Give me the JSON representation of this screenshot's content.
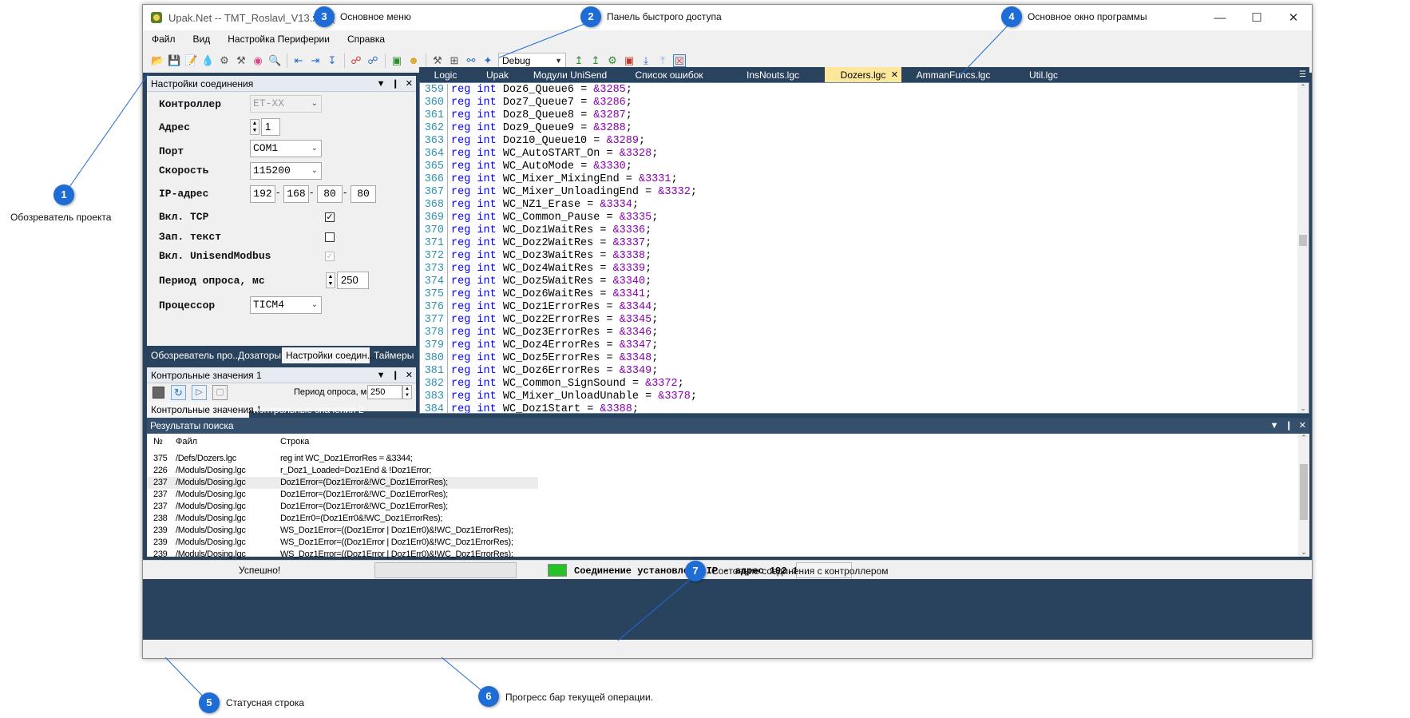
{
  "window": {
    "title": "Upak.Net -- TMT_Roslavl_V13.xml ("
  },
  "menu": [
    "Файл",
    "Вид",
    "Настройка Периферии",
    "Справка"
  ],
  "toolbar": {
    "config": "Debug",
    "icons": [
      "open-icon",
      "save-icon",
      "save-as-icon",
      "fire-icon",
      "settings-icon",
      "tools-icon",
      "color-wheel-icon",
      "search-icon",
      "align-left-icon",
      "align-right-icon",
      "download-icon",
      "link-icon",
      "unlink-icon",
      "chip-icon",
      "smile-icon",
      "hammer-icon",
      "grid-icon",
      "glasses-icon",
      "broom-icon",
      "upload-green-icon",
      "upload-green2-icon",
      "gear-green-icon",
      "stop-icon",
      "download-blue-icon",
      "upload-blue-icon",
      "disconnect-icon"
    ]
  },
  "conn_panel": {
    "title": "Настройки соединения",
    "labels": {
      "controller": "Контроллер",
      "address": "Адрес",
      "port": "Порт",
      "speed": "Скорость",
      "ip": "IP-адрес",
      "tcp": "Вкл. TCP",
      "write_text": "Зап. текст",
      "unisend": "Вкл. UnisendModbus",
      "period": "Период опроса, мс",
      "processor": "Процессор"
    },
    "values": {
      "controller": "ET-XX",
      "address": "1",
      "port": "COM1",
      "speed": "115200",
      "ip": [
        "192",
        "168",
        "80",
        "80"
      ],
      "tcp": "✓",
      "write_text": "",
      "unisend": "✓",
      "period": "250",
      "processor": "TICM4"
    },
    "tabs": [
      "Обозреватель про...",
      "Дозаторы",
      "Настройки соедин...",
      "Таймеры"
    ]
  },
  "cv_panel": {
    "title": "Контрольные значения 1",
    "period_label": "Период опроса, мс",
    "period_value": "250",
    "tabs": [
      "Контрольные значения 1",
      "Контрольные значения 2"
    ]
  },
  "editor": {
    "tabs": [
      "Logic",
      "Upak",
      "Модули UniSend",
      "Список ошибок",
      "InsNouts.lgc",
      "Dozers.lgc",
      "AmmanFuncs.lgc",
      "Util.lgc"
    ],
    "active_tab": "Dozers.lgc",
    "lines": [
      {
        "n": "359",
        "kw1": "reg",
        "kw2": "int",
        "name": "Doz6_Queue6",
        "val": "&3285",
        "end": ";"
      },
      {
        "n": "360",
        "kw1": "reg",
        "kw2": "int",
        "name": "Doz7_Queue7",
        "val": "&3286",
        "end": ";"
      },
      {
        "n": "361",
        "kw1": "reg",
        "kw2": "int",
        "name": "Doz8_Queue8",
        "val": "&3287",
        "end": ";"
      },
      {
        "n": "362",
        "kw1": "reg",
        "kw2": "int",
        "name": "Doz9_Queue9",
        "val": "&3288",
        "end": ";"
      },
      {
        "n": "363",
        "kw1": "reg",
        "kw2": "int",
        "name": "Doz10_Queue10",
        "val": "&3289",
        "end": ";"
      },
      {
        "n": "364",
        "kw1": "reg",
        "kw2": "int",
        "name": "WC_AutoSTART_On",
        "val": "&3328",
        "end": ";"
      },
      {
        "n": "365",
        "kw1": "reg",
        "kw2": "int",
        "name": "WC_AutoMode",
        "val": "&3330",
        "end": ";"
      },
      {
        "n": "366",
        "kw1": "reg",
        "kw2": "int",
        "name": "WC_Mixer_MixingEnd",
        "val": "&3331",
        "end": ";"
      },
      {
        "n": "367",
        "kw1": "reg",
        "kw2": "int",
        "name": "WC_Mixer_UnloadingEnd",
        "val": "&3332",
        "end": ";"
      },
      {
        "n": "368",
        "kw1": "reg",
        "kw2": "int",
        "name": "WC_NZ1_Erase",
        "val": "&3334",
        "end": ";"
      },
      {
        "n": "369",
        "kw1": "reg",
        "kw2": "int",
        "name": "WC_Common_Pause",
        "val": "&3335",
        "end": ";"
      },
      {
        "n": "370",
        "kw1": "reg",
        "kw2": "int",
        "name": "WC_Doz1WaitRes",
        "val": "&3336",
        "end": ";"
      },
      {
        "n": "371",
        "kw1": "reg",
        "kw2": "int",
        "name": "WC_Doz2WaitRes",
        "val": "&3337",
        "end": ";"
      },
      {
        "n": "372",
        "kw1": "reg",
        "kw2": "int",
        "name": "WC_Doz3WaitRes",
        "val": "&3338",
        "end": ";"
      },
      {
        "n": "373",
        "kw1": "reg",
        "kw2": "int",
        "name": "WC_Doz4WaitRes",
        "val": "&3339",
        "end": ";"
      },
      {
        "n": "374",
        "kw1": "reg",
        "kw2": "int",
        "name": "WC_Doz5WaitRes",
        "val": "&3340",
        "end": ";"
      },
      {
        "n": "375",
        "kw1": "reg",
        "kw2": "int",
        "name": "WC_Doz6WaitRes",
        "val": "&3341",
        "end": ";"
      },
      {
        "n": "376",
        "kw1": "reg",
        "kw2": "int",
        "name": "WC_Doz1ErrorRes",
        "val": "&3344",
        "end": ";"
      },
      {
        "n": "377",
        "kw1": "reg",
        "kw2": "int",
        "name": "WC_Doz2ErrorRes",
        "val": "&3345",
        "end": ";"
      },
      {
        "n": "378",
        "kw1": "reg",
        "kw2": "int",
        "name": "WC_Doz3ErrorRes",
        "val": "&3346",
        "end": ";"
      },
      {
        "n": "379",
        "kw1": "reg",
        "kw2": "int",
        "name": "WC_Doz4ErrorRes",
        "val": "&3347",
        "end": ";"
      },
      {
        "n": "380",
        "kw1": "reg",
        "kw2": "int",
        "name": "WC_Doz5ErrorRes",
        "val": "&3348",
        "end": ";"
      },
      {
        "n": "381",
        "kw1": "reg",
        "kw2": "int",
        "name": "WC_Doz6ErrorRes",
        "val": "&3349",
        "end": ";"
      },
      {
        "n": "382",
        "kw1": "reg",
        "kw2": "int",
        "name": "WC_Common_SignSound",
        "val": "&3372",
        "end": ";"
      },
      {
        "n": "383",
        "kw1": "reg",
        "kw2": "int",
        "name": "WC_Mixer_UnloadUnable",
        "val": "&3378",
        "end": ";"
      },
      {
        "n": "384",
        "kw1": "reg",
        "kw2": "int",
        "name": "WC_Doz1Start",
        "val": "&3388",
        "end": ";"
      }
    ]
  },
  "search": {
    "title": "Результаты поиска",
    "headers": [
      "№",
      "Файл",
      "Строка"
    ],
    "rows": [
      {
        "no": "375",
        "file": "/Defs/Dozers.lgc",
        "line": "reg int WC_Doz1ErrorRes = &3344;"
      },
      {
        "no": "226",
        "file": "/Moduls/Dosing.lgc",
        "line": "r_Doz1_Loaded=Doz1End & !Doz1Error;"
      },
      {
        "no": "237",
        "file": "/Moduls/Dosing.lgc",
        "line": "Doz1Error=(Doz1Error&!WC_Doz1ErrorRes);"
      },
      {
        "no": "237",
        "file": "/Moduls/Dosing.lgc",
        "line": "Doz1Error=(Doz1Error&!WC_Doz1ErrorRes);"
      },
      {
        "no": "237",
        "file": "/Moduls/Dosing.lgc",
        "line": "Doz1Error=(Doz1Error&!WC_Doz1ErrorRes);"
      },
      {
        "no": "238",
        "file": "/Moduls/Dosing.lgc",
        "line": "Doz1Err0=(Doz1Err0&!WC_Doz1ErrorRes);"
      },
      {
        "no": "239",
        "file": "/Moduls/Dosing.lgc",
        "line": "WS_Doz1Error=((Doz1Error | Doz1Err0)&!WC_Doz1ErrorRes);"
      },
      {
        "no": "239",
        "file": "/Moduls/Dosing.lgc",
        "line": "WS_Doz1Error=((Doz1Error | Doz1Err0)&!WC_Doz1ErrorRes);"
      },
      {
        "no": "239",
        "file": "/Moduls/Dosing.lgc",
        "line": "WS_Doz1Error=((Doz1Error | Doz1Err0)&!WC_Doz1ErrorRes);"
      }
    ]
  },
  "status": {
    "text": "Успешно!",
    "progress": 0,
    "connection_text": "Соединение установлено IP - адрес 192.168.80.80",
    "led_color": "#26c126"
  },
  "callouts": [
    {
      "n": "1",
      "label": "Обозреватель проекта"
    },
    {
      "n": "2",
      "label": "Панель быстрого доступа"
    },
    {
      "n": "3",
      "label": "Основное меню"
    },
    {
      "n": "4",
      "label": "Основное окно программы"
    },
    {
      "n": "5",
      "label": "Статусная строка"
    },
    {
      "n": "6",
      "label": "Прогресс бар текущей операции."
    },
    {
      "n": "7",
      "label": "Состояние соединения с контроллером"
    }
  ]
}
